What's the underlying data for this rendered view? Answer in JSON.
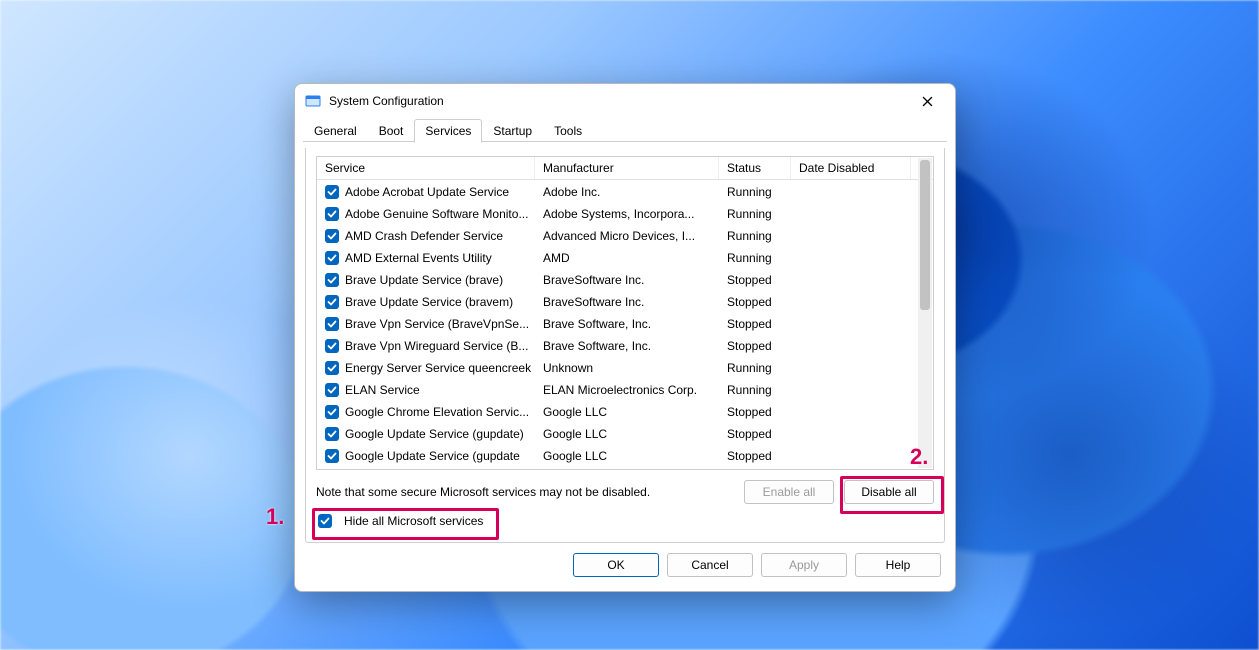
{
  "window": {
    "title": "System Configuration"
  },
  "tabs": [
    "General",
    "Boot",
    "Services",
    "Startup",
    "Tools"
  ],
  "active_tab_index": 2,
  "columns": {
    "service": "Service",
    "manufacturer": "Manufacturer",
    "status": "Status",
    "date_disabled": "Date Disabled"
  },
  "services": [
    {
      "checked": true,
      "name": "Adobe Acrobat Update Service",
      "manufacturer": "Adobe Inc.",
      "status": "Running",
      "date_disabled": ""
    },
    {
      "checked": true,
      "name": "Adobe Genuine Software Monito...",
      "manufacturer": "Adobe Systems, Incorpora...",
      "status": "Running",
      "date_disabled": ""
    },
    {
      "checked": true,
      "name": "AMD Crash Defender Service",
      "manufacturer": "Advanced Micro Devices, I...",
      "status": "Running",
      "date_disabled": ""
    },
    {
      "checked": true,
      "name": "AMD External Events Utility",
      "manufacturer": "AMD",
      "status": "Running",
      "date_disabled": ""
    },
    {
      "checked": true,
      "name": "Brave Update Service (brave)",
      "manufacturer": "BraveSoftware Inc.",
      "status": "Stopped",
      "date_disabled": ""
    },
    {
      "checked": true,
      "name": "Brave Update Service (bravem)",
      "manufacturer": "BraveSoftware Inc.",
      "status": "Stopped",
      "date_disabled": ""
    },
    {
      "checked": true,
      "name": "Brave Vpn Service (BraveVpnSe...",
      "manufacturer": "Brave Software, Inc.",
      "status": "Stopped",
      "date_disabled": ""
    },
    {
      "checked": true,
      "name": "Brave Vpn Wireguard Service (B...",
      "manufacturer": "Brave Software, Inc.",
      "status": "Stopped",
      "date_disabled": ""
    },
    {
      "checked": true,
      "name": "Energy Server Service queencreek",
      "manufacturer": "Unknown",
      "status": "Running",
      "date_disabled": ""
    },
    {
      "checked": true,
      "name": "ELAN Service",
      "manufacturer": "ELAN Microelectronics Corp.",
      "status": "Running",
      "date_disabled": ""
    },
    {
      "checked": true,
      "name": "Google Chrome Elevation Servic...",
      "manufacturer": "Google LLC",
      "status": "Stopped",
      "date_disabled": ""
    },
    {
      "checked": true,
      "name": "Google Update Service (gupdate)",
      "manufacturer": "Google LLC",
      "status": "Stopped",
      "date_disabled": ""
    },
    {
      "checked": true,
      "name": "Google Update Service (gupdate",
      "manufacturer": "Google LLC",
      "status": "Stopped",
      "date_disabled": ""
    }
  ],
  "note": "Note that some secure Microsoft services may not be disabled.",
  "hide_ms": {
    "checked": true,
    "label": "Hide all Microsoft services"
  },
  "buttons": {
    "enable_all": "Enable all",
    "disable_all": "Disable all",
    "ok": "OK",
    "cancel": "Cancel",
    "apply": "Apply",
    "help": "Help"
  },
  "annotations": {
    "one": "1.",
    "two": "2."
  },
  "colors": {
    "accent": "#0067c0",
    "annotation": "#d6005a"
  }
}
